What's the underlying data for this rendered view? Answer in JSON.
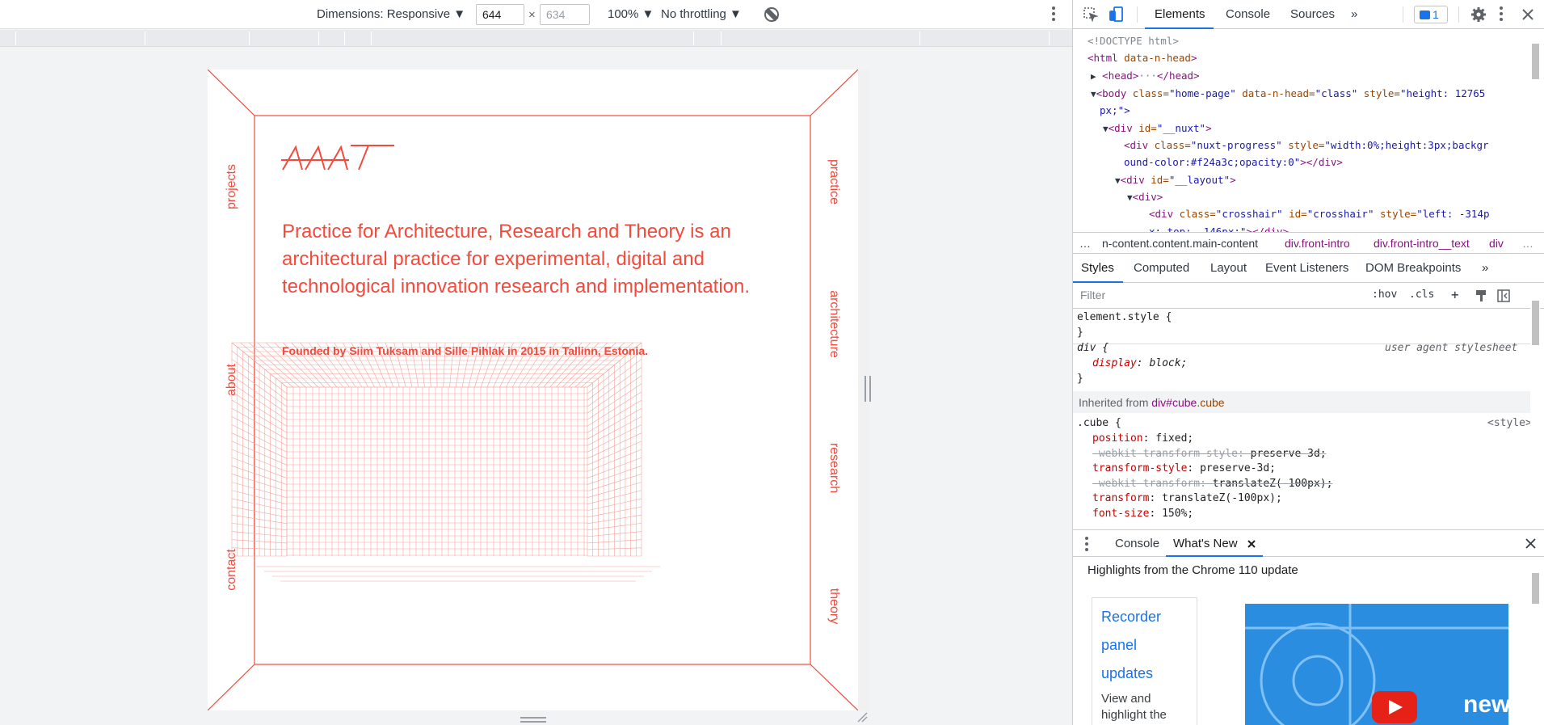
{
  "device_toolbar": {
    "dimensions_label": "Dimensions: Responsive ▼",
    "width_value": "644",
    "height_placeholder": "634",
    "times": "×",
    "zoom": "100% ▼",
    "throttling": "No throttling ▼"
  },
  "page": {
    "left_nav": [
      "projects",
      "about",
      "contact"
    ],
    "right_nav": [
      "practice",
      "architecture",
      "research",
      "theory"
    ],
    "headline": "Practice for Architecture, Research and Theory is an architectural practice for experimental, digital and technological innovation research and implementation.",
    "founded": "Founded by Siim Tuksam and Sille Pihlak in 2015 in Tallinn, Estonia.",
    "brand_color": "#f24a3c"
  },
  "devtools": {
    "tabs": [
      "Elements",
      "Console",
      "Sources",
      "»"
    ],
    "active_tab": "Elements",
    "issues_count": "1",
    "dom": [
      {
        "text": "<!DOCTYPE html>"
      },
      {
        "tag": "<html",
        "attrs": " data-n-head",
        "close": ">"
      },
      {
        "tag": "<head>",
        "mid": "···",
        "close": "</head>"
      },
      {
        "tag": "<body",
        "a1": " class=",
        "v1": "\"home-page\"",
        "a2": " data-n-head=",
        "v2": "\"class\"",
        "a3": " style=",
        "v3": "\"height: 12765"
      },
      {
        "cont": "px;\">"
      },
      {
        "tag": "<div",
        "a1": " id=",
        "v1": "\"__nuxt\"",
        "close": ">"
      },
      {
        "tag": "<div",
        "a1": " class=",
        "v1": "\"nuxt-progress\"",
        "a2": " style=",
        "v2": "\"width:0%;height:3px;backgr"
      },
      {
        "cont": "ound-color:#f24a3c;opacity:0\"",
        "close": "></div>"
      },
      {
        "tag": "<div",
        "a1": " id=",
        "v1": "\"__layout\"",
        "close": ">"
      },
      {
        "tag": "<div>"
      },
      {
        "tag": "<div",
        "a1": " class=",
        "v1": "\"crosshair\"",
        "a2": " id=",
        "v2": "\"crosshair\"",
        "a3": " style=",
        "v3": "\"left: -314p"
      },
      {
        "cont": "x; top: -146px;\"",
        "close": "></div>"
      }
    ],
    "breadcrumbs": [
      "…",
      "n-content.content.main-content",
      "div.front-intro",
      "div.front-intro__text",
      "div",
      "…"
    ],
    "sub_tabs": [
      "Styles",
      "Computed",
      "Layout",
      "Event Listeners",
      "DOM Breakpoints",
      "»"
    ],
    "filter_placeholder": "Filter",
    "filter_tools": [
      ":hov",
      ".cls",
      "+"
    ],
    "styles": {
      "element_style": "element.style {",
      "close_brace": "}",
      "div_selector": "div {",
      "ua_label": "user agent stylesheet",
      "div_prop": "display",
      "div_val": "block;",
      "inherited_prefix": "Inherited from ",
      "inherited_tag": "div",
      "inherited_id": "#cube",
      "inherited_class": ".cube",
      "cube_selector": ".cube {",
      "cube_source": "<style>",
      "cube_props": [
        {
          "name": "position",
          "value": "fixed;",
          "struck": false
        },
        {
          "name": "-webkit-transform-style",
          "value": "preserve-3d;",
          "struck": true
        },
        {
          "name": "transform-style",
          "value": "preserve-3d;",
          "struck": false
        },
        {
          "name": "-webkit-transform",
          "value": "translateZ(-100px);",
          "struck": true
        },
        {
          "name": "transform",
          "value": "translateZ(-100px);",
          "struck": false
        },
        {
          "name": "font-size",
          "value": "150%;",
          "struck": false
        }
      ]
    },
    "drawer_tabs": [
      "Console",
      "What's New"
    ],
    "whats_new": {
      "heading": "Highlights from the Chrome 110 update",
      "card_links": [
        "Recorder",
        "panel",
        "updates"
      ],
      "card_text": "View and highlight the code of your",
      "video_text": "new"
    }
  }
}
